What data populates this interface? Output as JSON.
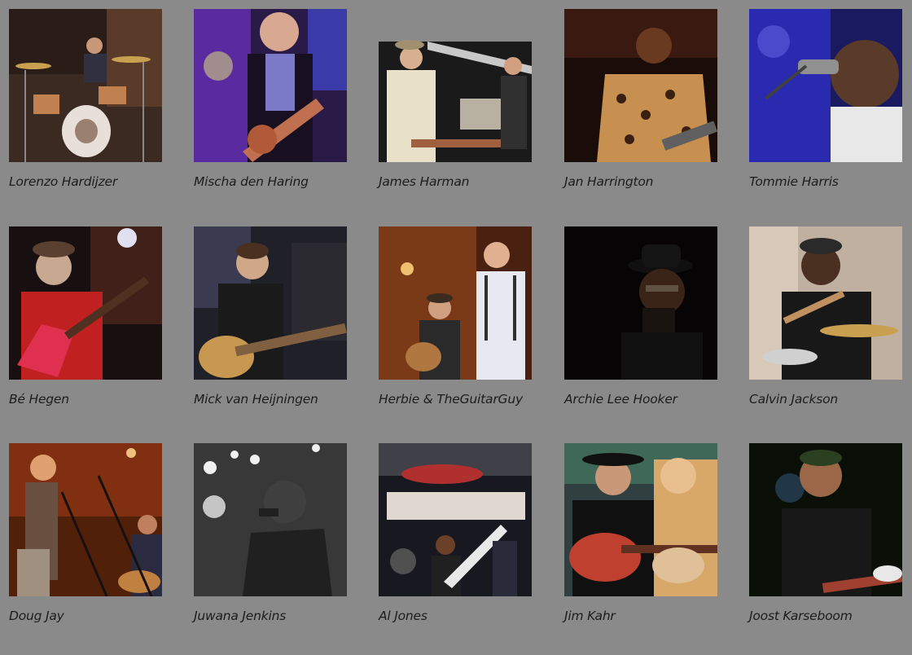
{
  "artists": [
    {
      "name": "Lorenzo Hardijzer",
      "photo": "drummer-on-stage-photo"
    },
    {
      "name": "Mischa den Haring",
      "photo": "guitarist-purple-light-photo"
    },
    {
      "name": "James Harman",
      "photo": "harmonica-player-stage-photo"
    },
    {
      "name": "Jan Harrington",
      "photo": "singer-leopard-dress-photo"
    },
    {
      "name": "Tommie Harris",
      "photo": "singer-blue-light-photo"
    },
    {
      "name": "Bé Hegen",
      "photo": "guitarist-red-jacket-photo"
    },
    {
      "name": "Mick van Heijningen",
      "photo": "young-guitarist-photo"
    },
    {
      "name": "Herbie & TheGuitarGuy",
      "photo": "duo-harmonica-guitar-photo"
    },
    {
      "name": "Archie Lee Hooker",
      "photo": "harmonica-player-dark-photo"
    },
    {
      "name": "Calvin Jackson",
      "photo": "drummer-smiling-photo"
    },
    {
      "name": "Doug Jay",
      "photo": "band-orange-light-photo"
    },
    {
      "name": "Juwana Jenkins",
      "photo": "singer-black-white-photo"
    },
    {
      "name": "Al Jones",
      "photo": "band-country-stage-photo"
    },
    {
      "name": "Jim Kahr",
      "photo": "two-guitarists-photo"
    },
    {
      "name": "Joost Karseboom",
      "photo": "guitarist-dark-green-photo"
    }
  ]
}
